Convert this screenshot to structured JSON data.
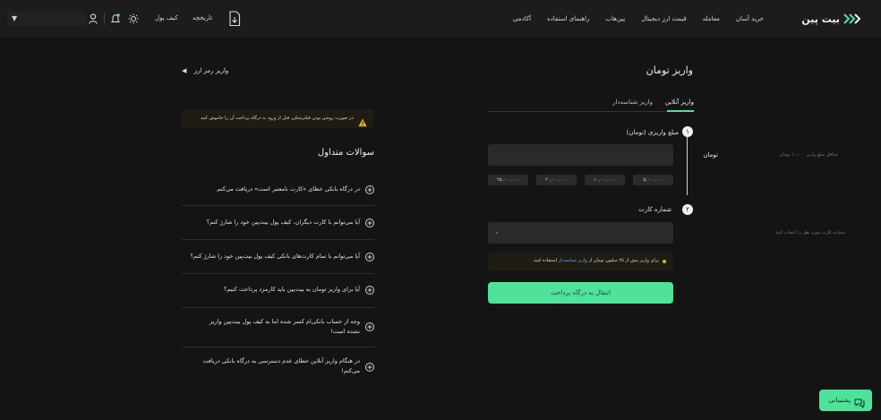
{
  "brand": {
    "name": "بیت پین",
    "accent": "#4ee29a"
  },
  "nav": {
    "items": [
      "خرید آسان",
      "معامله",
      "قیمت ارز دیجیتال",
      "پین‌هاب",
      "راهنمای استفاده",
      "آکادمی"
    ]
  },
  "header_tools": {
    "wallet_label": "کیف پول",
    "history_label": "تاریخچه"
  },
  "deposit": {
    "title": "واریز تومان",
    "tabs": [
      "واریز آنلاین",
      "واریز شناسه‌دار"
    ],
    "step1_num": "۱",
    "step1_label": "مبلغ واریزی (تومان)",
    "amount_unit": "تومان",
    "amount_placeholder": "حداقل مبلغ واریز ۱۰,۰۰۰ تومان",
    "presets": [
      "۲۵,۰۰۰,۰۰۰",
      "۲۰,۰۰۰,۰۰۰",
      "۱۰,۰۰۰,۰۰۰",
      "۵,۰۰۰,۰۰۰"
    ],
    "step2_num": "۲",
    "step2_label": "شماره کارت",
    "card_placeholder": "شماره کارت مورد نظر را انتخاب کنید",
    "notice_prefix": "برای واریز بیش از ۲۵ میلیون تومان از",
    "notice_link": "واریز شناسه‌دار",
    "notice_suffix": "استفاده کنید.",
    "submit_label": "انتقال به درگاه پرداخت"
  },
  "side": {
    "back_label": "واریز رمز ارز",
    "warning_text": "در صورت روشن بودن فیلترشکن، قبل از ورود به درگاه پرداخت آن را خاموش کنید.",
    "faq_title": "سوالات متداول",
    "faq": [
      "در درگاه بانکی خطای «کارت نامعتبر است» دریافت می‌کنم.",
      "آیا می‌توانم با کارت دیگران، کیف پول بیت‌پین خود را شارژ کنم؟",
      "آیا می‌توانم با تمام کارت‌های بانکی کیف پول بیت‌پین خود را شارژ کنم؟",
      "آیا برای واریز تومان به بیت‌پین باید کارمزد پرداخت کنیم؟",
      "وجه از حساب بانکی‌ام کسر شده اما به کیف پول بیت‌پین واریز نشده است!",
      "در هنگام واریز آنلاین خطای عدم دسترسی به درگاه بانکی دریافت می‌کنم!"
    ]
  },
  "support": {
    "label": "پشتیبانی"
  }
}
